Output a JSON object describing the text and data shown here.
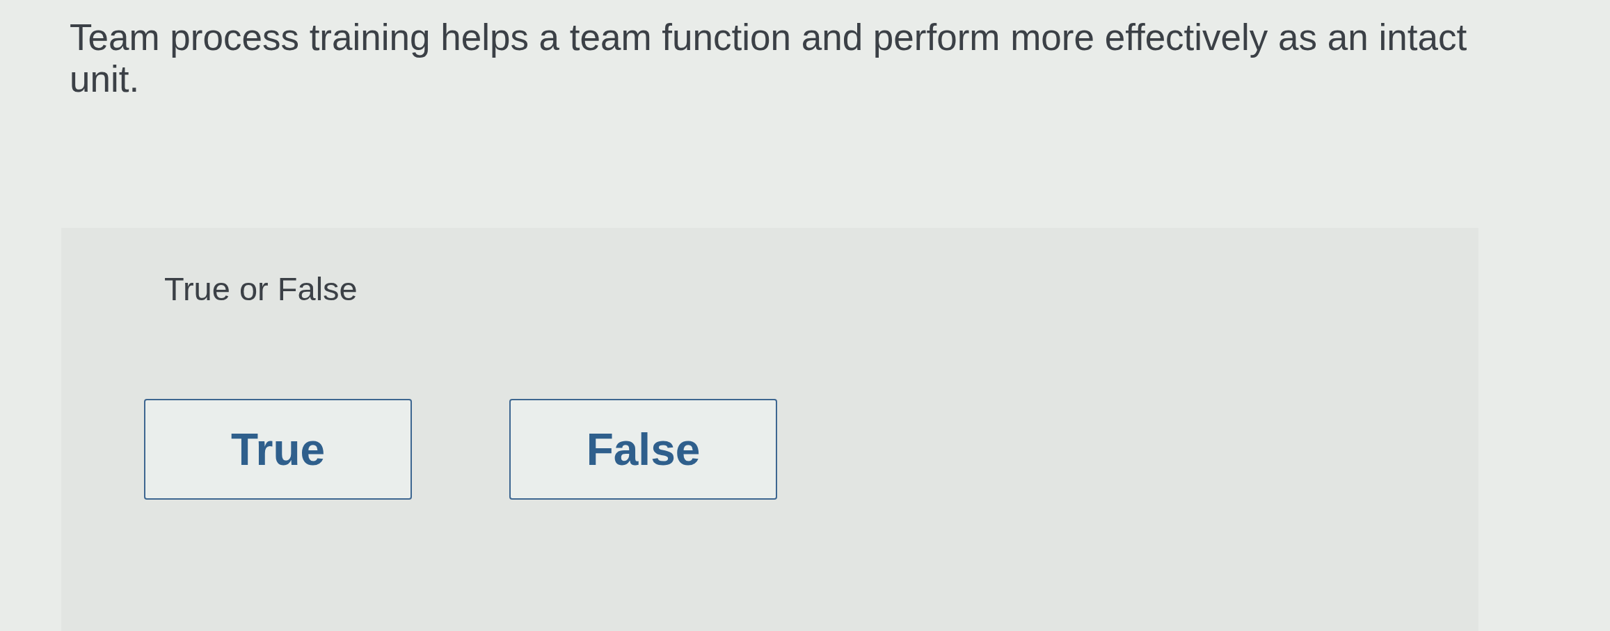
{
  "question": {
    "text": "Team process training helps a team function and perform more effectively as an intact unit."
  },
  "answer_panel": {
    "instruction": "True or False",
    "choices": [
      {
        "label": "True",
        "selected": false
      },
      {
        "label": "False",
        "selected": false
      }
    ]
  }
}
